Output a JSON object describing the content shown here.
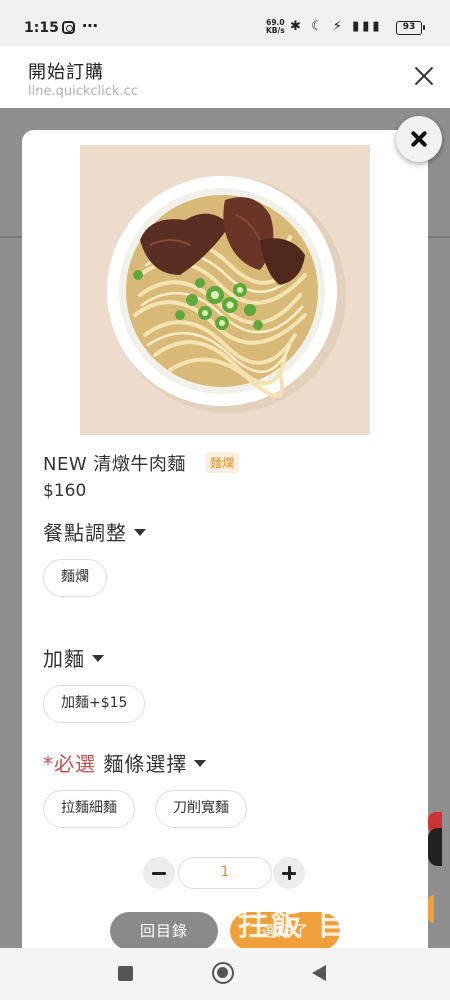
{
  "status_bar": {
    "time": "1:15",
    "more": "⋯",
    "speed_value": "69.0",
    "speed_unit": "KB/s",
    "icons": "✱ ☾ ⚡ ▮▮▮",
    "battery": "93"
  },
  "browser": {
    "title": "開始訂購",
    "url": "line.quickclick.cc"
  },
  "product": {
    "name": "NEW 清燉牛肉麵",
    "tag": "麵爛",
    "price": "$160",
    "image_icon": "beef-noodle-soup-image"
  },
  "sections": [
    {
      "required": "",
      "title": "餐點調整",
      "options": [
        "麵爛"
      ]
    },
    {
      "required": "",
      "title": "加麵",
      "options": [
        "加麵+$15"
      ]
    },
    {
      "required": "*必選",
      "title": "麵條選擇",
      "options": [
        "拉麵細麵",
        "刀削寬麵"
      ]
    }
  ],
  "quantity": {
    "value": "1"
  },
  "actions": {
    "back_label": "回目錄",
    "confirm_label": "選好了"
  },
  "watermark": "拄飯 目",
  "colors": {
    "accent": "#f0a03a",
    "required": "#c0504d",
    "tag_bg": "#fdf0e0"
  }
}
